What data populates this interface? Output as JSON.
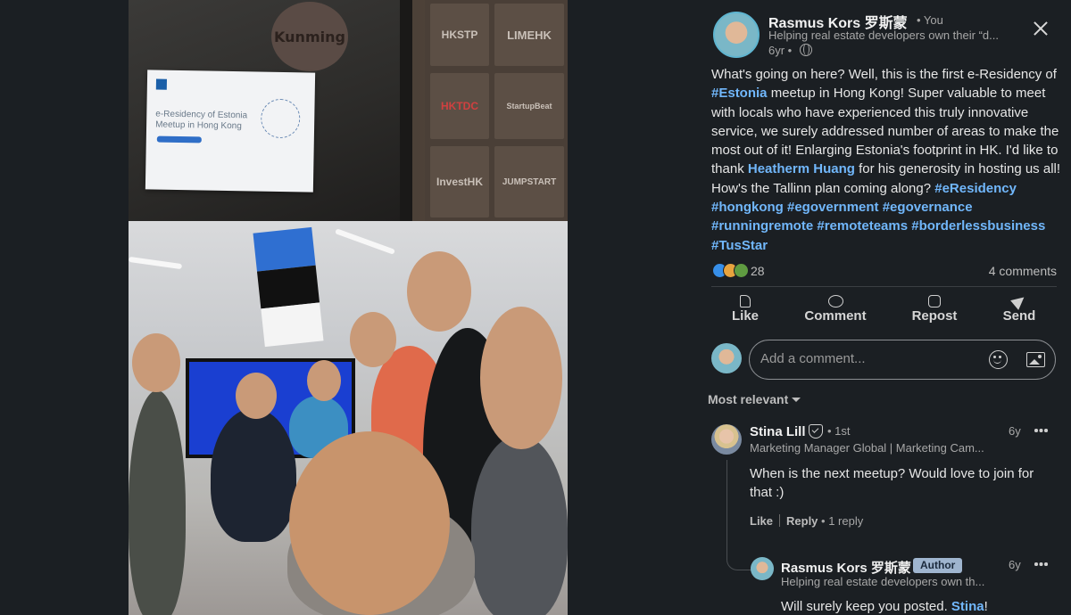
{
  "photo": {
    "sign_text": "Kunming",
    "poster_title": "e-Residency of Estonia Meetup in Hong Kong",
    "wall_logos": [
      "HKSTP",
      "LIMEHK",
      "HKTDC",
      "StartupBeat",
      "InvestHK",
      "JUMPSTART"
    ],
    "flag_colors": [
      "#2f6fd1",
      "#111111",
      "#f4f4f4"
    ]
  },
  "post": {
    "author_name": "Rasmus Kors 罗斯蒙",
    "author_tag": "• You",
    "author_headline": "Helping real estate developers own their “d...",
    "time": "6yr •",
    "text_parts": [
      {
        "t": "What's going on here? Well, this is the first e-Residency of ",
        "link": false
      },
      {
        "t": "#Estonia",
        "link": true
      },
      {
        "t": " meetup in Hong Kong! Super valuable to meet with locals who have experienced this truly innovative service, we surely addressed number of areas to make the most out of it! Enlarging Estonia's footprint in HK. I'd like to thank ",
        "link": false
      },
      {
        "t": "Heatherm Huang",
        "link": true
      },
      {
        "t": " for his generosity in hosting us all! How's the Tallinn plan coming along? ",
        "link": false
      },
      {
        "t": "#eResidency",
        "link": true
      },
      {
        "t": " ",
        "link": false
      },
      {
        "t": "#hongkong",
        "link": true
      },
      {
        "t": " ",
        "link": false
      },
      {
        "t": "#egovernment",
        "link": true
      },
      {
        "t": " ",
        "link": false
      },
      {
        "t": "#egovernance",
        "link": true
      },
      {
        "t": " ",
        "link": false
      },
      {
        "t": "#runningremote",
        "link": true
      },
      {
        "t": " ",
        "link": false
      },
      {
        "t": "#remoteteams",
        "link": true
      },
      {
        "t": " ",
        "link": false
      },
      {
        "t": "#borderlessbusiness",
        "link": true
      },
      {
        "t": " ",
        "link": false
      },
      {
        "t": "#TusStar",
        "link": true
      }
    ],
    "reaction_count": "28",
    "comments_count": "4 comments",
    "reaction_colors": [
      "#378fe9",
      "#e7a33e",
      "#5f9b41"
    ]
  },
  "actions": {
    "like": "Like",
    "comment": "Comment",
    "repost": "Repost",
    "send": "Send"
  },
  "composer": {
    "placeholder": "Add a comment..."
  },
  "sort_label": "Most relevant",
  "comments": [
    {
      "name": "Stina Lill",
      "degree": "• 1st",
      "headline": "Marketing Manager Global | Marketing Cam...",
      "time": "6y",
      "text": "When is the next meetup? Would love to join for that :)",
      "like": "Like",
      "reply": "Reply",
      "replies": "• 1 reply"
    },
    {
      "name": "Rasmus Kors 罗斯蒙",
      "badge": "Author",
      "headline": "Helping real estate developers own th...",
      "time": "6y",
      "text": "Will surely keep you posted. ",
      "mention": "Stina",
      "text_end": "!"
    }
  ],
  "link_color": "#71b7fb"
}
